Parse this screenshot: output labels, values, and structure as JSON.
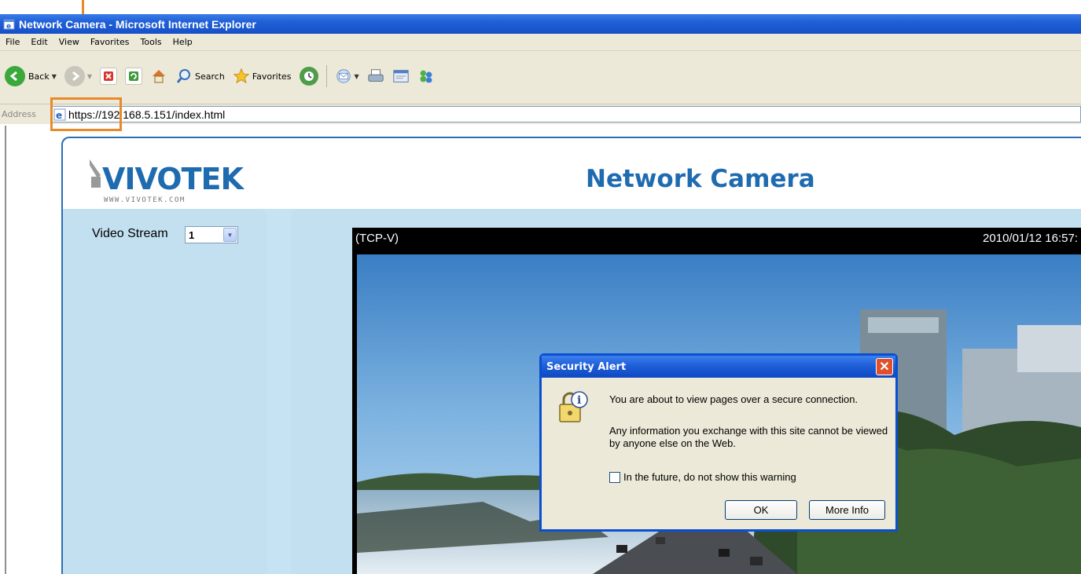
{
  "window": {
    "title": "Network Camera - Microsoft Internet Explorer"
  },
  "menu": [
    "File",
    "Edit",
    "View",
    "Favorites",
    "Tools",
    "Help"
  ],
  "toolbar": {
    "back_label": "Back",
    "search_label": "Search",
    "favorites_label": "Favorites"
  },
  "address": {
    "label": "Address",
    "url": "https://192.168.5.151/index.html"
  },
  "page": {
    "logo_text": "VIVOTEK",
    "logo_sub": "WWW.VIVOTEK.COM",
    "title": "Network Camera",
    "video_stream_label": "Video Stream",
    "video_stream_value": "1",
    "video_mode": "(TCP-V)",
    "video_timestamp": "2010/01/12 16:57:"
  },
  "dialog": {
    "title": "Security Alert",
    "message_1": "You are about to view pages over a secure connection.",
    "message_2": "Any information you exchange with this site cannot be viewed by anyone else on the Web.",
    "checkbox_label": "In the future, do not show this warning",
    "ok_label": "OK",
    "more_info_label": "More Info"
  },
  "colors": {
    "annotation": "#e8892a",
    "page_bg": "#c5e3f3",
    "title_blue": "#1f6bb0",
    "xp_titlebar": "#1f5fd6"
  }
}
